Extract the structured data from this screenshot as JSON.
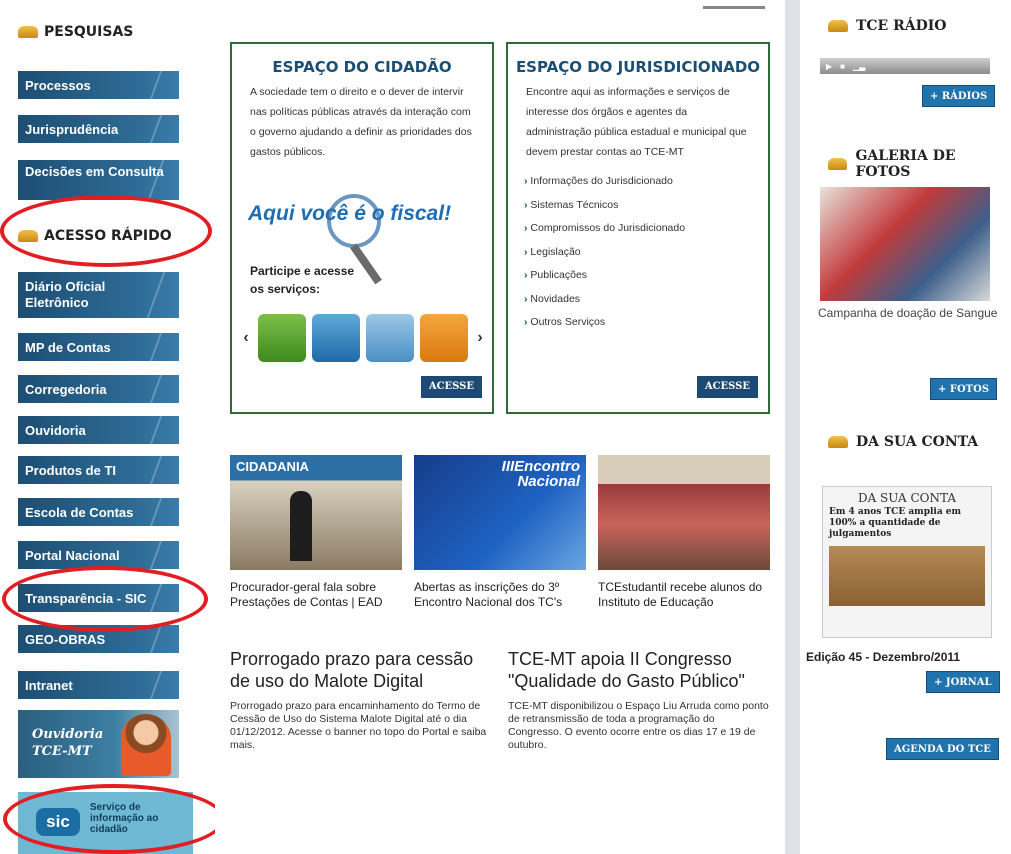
{
  "left": {
    "pesquisas": "PESQUISAS",
    "acesso_rapido": "ACESSO RÁPIDO",
    "search_items": [
      "Processos",
      "Jurisprudência",
      "Decisões em Consulta"
    ],
    "quick_items": [
      "Diário Oficial Eletrônico",
      "MP de Contas",
      "Corregedoria",
      "Ouvidoria",
      "Produtos de TI",
      "Escola de Contas",
      "Portal Nacional",
      "Transparência - SIC",
      "GEO-OBRAS",
      "Intranet"
    ],
    "ouvidoria_banner": "Ouvidoria TCE-MT",
    "sic": {
      "logo": "sic",
      "text": "Serviço de informação ao cidadão"
    }
  },
  "cidadao": {
    "title": "ESPAÇO DO CIDADÃO",
    "text": "A sociedade tem o direito e o dever de intervir nas políticas públicas através da interação com o governo ajudando a definir as prioridades dos gastos públicos.",
    "slogan": "Aqui você é o fiscal!",
    "participe": "Participe e acesse os serviços:",
    "prev": "‹",
    "next": "›",
    "button": "ACESSE"
  },
  "jurisdicionado": {
    "title": "ESPAÇO DO JURISDICIONADO",
    "text": "Encontre aqui as informações e serviços de interesse dos órgãos e agentes da administração pública estadual e municipal que devem prestar contas ao TCE-MT",
    "links": [
      "Informações do Jurisdicionado",
      "Sistemas Técnicos",
      "Compromissos do Jurisdicionado",
      "Legislação",
      "Publicações",
      "Novidades",
      "Outros Serviços"
    ],
    "button": "ACESSE"
  },
  "thumbs": [
    {
      "caption": "Procurador-geral fala sobre Prestações de Contas | EAD",
      "label": "CIDADANIA"
    },
    {
      "caption": "Abertas as inscrições do 3º Encontro Nacional dos TC's",
      "label": "IIIEncontro Nacional"
    },
    {
      "caption": "TCEstudantil recebe alunos do Instituto de Educação",
      "label": ""
    }
  ],
  "news": [
    {
      "title": "Prorrogado prazo para cessão de uso do Malote Digital",
      "body": "Prorrogado prazo para encaminhamento do Termo de Cessão de Uso do Sistema Malote Digital até o dia 01/12/2012. Acesse o banner no topo do Portal e saiba mais."
    },
    {
      "title": "TCE-MT apoia II Congresso \"Qualidade do Gasto Público\"",
      "body": "TCE-MT disponibilizou o Espaço Liu Arruda como ponto de retransmissão de toda a programação do Congresso. O evento ocorre entre os dias 17 e 19 de outubro."
    }
  ],
  "right": {
    "radio": "TCE RÁDIO",
    "radios_btn": "+ RÁDIOS",
    "galeria": "GALERIA DE FOTOS",
    "foto_caption": "Campanha de doação de Sangue",
    "fotos_btn": "+ FOTOS",
    "da_sua_conta": "DA SUA CONTA",
    "jornal_headline": "Em 4 anos TCE amplia em 100% a quantidade de julgamentos",
    "edicao": "Edição 45 - Dezembro/2011",
    "jornal_btn": "+ JORNAL",
    "agenda_btn": "AGENDA DO TCE"
  },
  "colors": {
    "nav": "#2d6a94",
    "highlight_oval": "#e01e24",
    "box_border": "#2e6b3a",
    "title_blue": "#1a4e73"
  }
}
